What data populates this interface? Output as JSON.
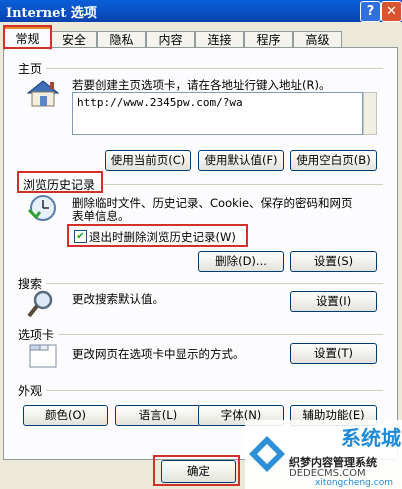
{
  "window": {
    "title": "Internet 选项",
    "help_label": "?",
    "close_label": "✕"
  },
  "tabs": [
    "常规",
    "安全",
    "隐私",
    "内容",
    "连接",
    "程序",
    "高级"
  ],
  "home": {
    "heading": "主页",
    "description": "若要创建主页选项卡，请在各地址行键入地址(R)。",
    "url": "http://www.2345pw.com/?wa",
    "btn_current": "使用当前页(C)",
    "btn_default": "使用默认值(F)",
    "btn_blank": "使用空白页(B)"
  },
  "history": {
    "heading": "浏览历史记录",
    "description_line1": "删除临时文件、历史记录、Cookie、保存的密码和网页",
    "description_line2": "表单信息。",
    "checkbox_label": "退出时删除浏览历史记录(W)",
    "checkbox_checked": true,
    "btn_delete": "删除(D)...",
    "btn_settings": "设置(S)"
  },
  "search": {
    "heading": "搜索",
    "description": "更改搜索默认值。",
    "btn_settings": "设置(I)"
  },
  "tabsect": {
    "heading": "选项卡",
    "description": "更改网页在选项卡中显示的方式。",
    "btn_settings": "设置(T)"
  },
  "appearance": {
    "heading": "外观",
    "btn_colors": "颜色(O)",
    "btn_languages": "语言(L)",
    "btn_fonts": "字体(N)",
    "btn_accessibility": "辅助功能(E)"
  },
  "footer": {
    "ok_label": "确定"
  },
  "watermark": {
    "line1": "织梦内容管理系统",
    "line2": "DEDECMS.COM",
    "brand": "系统城",
    "domain": "xitongcheng.com"
  },
  "colors": {
    "highlight": "#d3302c",
    "titlebar": "#0842b0"
  }
}
